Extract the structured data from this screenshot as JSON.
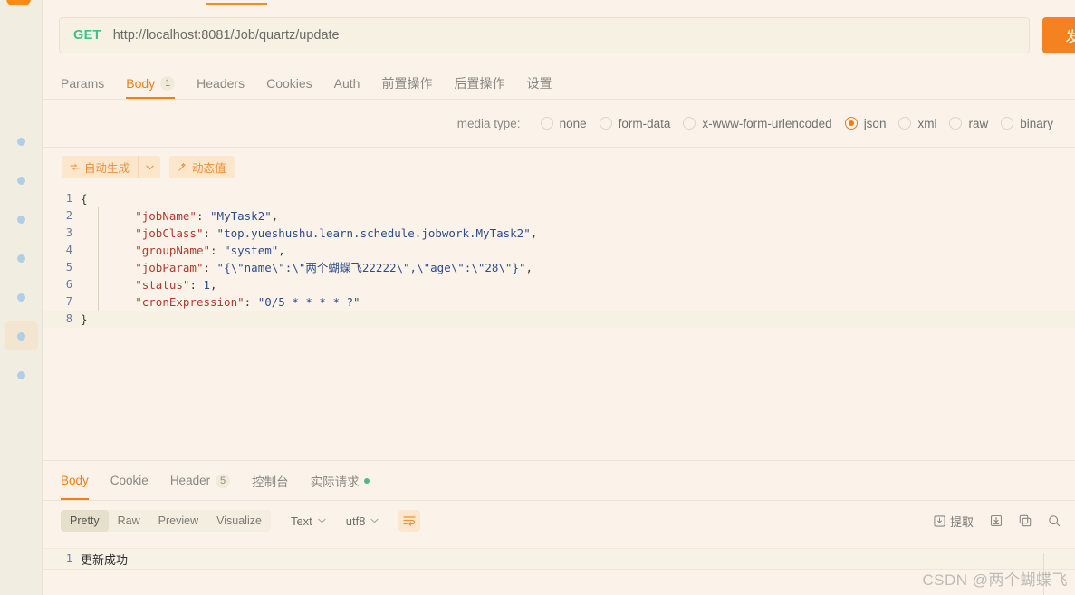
{
  "colors": {
    "accent_orange": "#F58220",
    "tab_active": "#EE8016",
    "method_green": "#3DC08A",
    "bg_main": "#FBF3EA",
    "bg_rail": "#F1EEE1",
    "dot_blue": "#AFCFE8",
    "status_green": "#52B788"
  },
  "sidebar": {
    "items": [
      {
        "name": "rail-icon-1"
      },
      {
        "name": "rail-icon-2"
      },
      {
        "name": "rail-icon-3"
      },
      {
        "name": "rail-icon-4"
      },
      {
        "name": "rail-icon-5"
      },
      {
        "name": "rail-icon-6",
        "active": true
      },
      {
        "name": "rail-icon-7"
      }
    ]
  },
  "request": {
    "method": "GET",
    "url": "http://localhost:8081/Job/quartz/update",
    "send_label": "发送",
    "tabs": [
      {
        "label": "Params",
        "badge": "",
        "active": false
      },
      {
        "label": "Body",
        "badge": "1",
        "active": true
      },
      {
        "label": "Headers",
        "badge": "",
        "active": false
      },
      {
        "label": "Cookies",
        "badge": "",
        "active": false
      },
      {
        "label": "Auth",
        "badge": "",
        "active": false
      },
      {
        "label": "前置操作",
        "badge": "",
        "active": false
      },
      {
        "label": "后置操作",
        "badge": "",
        "active": false
      },
      {
        "label": "设置",
        "badge": "",
        "active": false
      }
    ],
    "media_type": {
      "label": "media type:",
      "selected": "json",
      "options": [
        "none",
        "form-data",
        "x-www-form-urlencoded",
        "json",
        "xml",
        "raw",
        "binary"
      ]
    },
    "body_toolbar": {
      "auto_generate_label": "自动生成",
      "auto_generate_icon": "refresh-icon",
      "caret_icon": "chevron-down-icon",
      "dynamic_value_label": "动态值",
      "dynamic_value_icon": "magic-wand-icon"
    },
    "body_code": [
      {
        "num": "1",
        "segments": [
          {
            "t": "{",
            "c": "p"
          }
        ]
      },
      {
        "num": "2",
        "segments": [
          {
            "t": "        ",
            "c": "p"
          },
          {
            "t": "\"jobName\"",
            "c": "k"
          },
          {
            "t": ": ",
            "c": "p"
          },
          {
            "t": "\"MyTask2\"",
            "c": "s"
          },
          {
            "t": ",",
            "c": "p"
          }
        ]
      },
      {
        "num": "3",
        "segments": [
          {
            "t": "        ",
            "c": "p"
          },
          {
            "t": "\"jobClass\"",
            "c": "k"
          },
          {
            "t": ": ",
            "c": "p"
          },
          {
            "t": "\"top.yueshushu.learn.schedule.jobwork.MyTask2\"",
            "c": "s"
          },
          {
            "t": ",",
            "c": "p"
          }
        ]
      },
      {
        "num": "4",
        "segments": [
          {
            "t": "        ",
            "c": "p"
          },
          {
            "t": "\"groupName\"",
            "c": "k"
          },
          {
            "t": ": ",
            "c": "p"
          },
          {
            "t": "\"system\"",
            "c": "s"
          },
          {
            "t": ",",
            "c": "p"
          }
        ]
      },
      {
        "num": "5",
        "segments": [
          {
            "t": "        ",
            "c": "p"
          },
          {
            "t": "\"jobParam\"",
            "c": "k"
          },
          {
            "t": ": ",
            "c": "p"
          },
          {
            "t": "\"{\\\"name\\\":\\\"两个蝴蝶飞22222\\\",\\\"age\\\":\\\"28\\\"}\"",
            "c": "s"
          },
          {
            "t": ",",
            "c": "p"
          }
        ]
      },
      {
        "num": "6",
        "segments": [
          {
            "t": "        ",
            "c": "p"
          },
          {
            "t": "\"status\"",
            "c": "k"
          },
          {
            "t": ": ",
            "c": "p"
          },
          {
            "t": "1",
            "c": "n"
          },
          {
            "t": ",",
            "c": "p"
          }
        ]
      },
      {
        "num": "7",
        "segments": [
          {
            "t": "        ",
            "c": "p"
          },
          {
            "t": "\"cronExpression\"",
            "c": "k"
          },
          {
            "t": ": ",
            "c": "p"
          },
          {
            "t": "\"0/5 * * * * ?\"",
            "c": "s"
          }
        ]
      },
      {
        "num": "8",
        "segments": [
          {
            "t": "}",
            "c": "p"
          }
        ],
        "highlight": true
      }
    ]
  },
  "response": {
    "tabs": [
      {
        "label": "Body",
        "badge": "",
        "active": true,
        "dot": false
      },
      {
        "label": "Cookie",
        "badge": "",
        "active": false,
        "dot": false
      },
      {
        "label": "Header",
        "badge": "5",
        "active": false,
        "dot": false
      },
      {
        "label": "控制台",
        "badge": "",
        "active": false,
        "dot": false
      },
      {
        "label": "实际请求",
        "badge": "",
        "active": false,
        "dot": true
      }
    ],
    "view_modes": [
      {
        "label": "Pretty",
        "active": true
      },
      {
        "label": "Raw",
        "active": false
      },
      {
        "label": "Preview",
        "active": false
      },
      {
        "label": "Visualize",
        "active": false
      }
    ],
    "format_select": "Text",
    "encoding_select": "utf8",
    "wrap_icon": "wrap-text-icon",
    "actions": [
      {
        "label": "提取",
        "icon": "extract-icon"
      },
      {
        "label": "",
        "icon": "save-icon"
      },
      {
        "label": "",
        "icon": "copy-icon"
      },
      {
        "label": "",
        "icon": "search-icon"
      }
    ],
    "body_lines": [
      {
        "num": "1",
        "text": "更新成功"
      }
    ]
  },
  "watermark": "CSDN @两个蝴蝶飞"
}
